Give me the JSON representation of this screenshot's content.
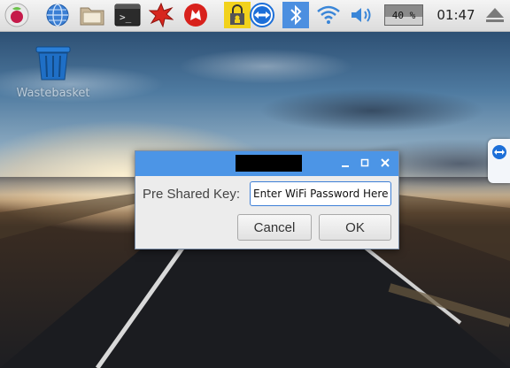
{
  "taskbar": {
    "launchers": [
      "raspberry-menu-icon",
      "web-browser-icon",
      "file-manager-icon",
      "terminal-icon",
      "mathematica-icon",
      "wolfram-icon"
    ],
    "tray": [
      "vnc-lock-icon",
      "teamviewer-icon",
      "bluetooth-icon",
      "wifi-icon",
      "volume-icon",
      "eject-icon"
    ],
    "cpu_percent": 40,
    "cpu_label": "40 %",
    "clock": "01:47",
    "accent": "#4c95e6"
  },
  "desktop": {
    "wastebasket_label": "Wastebasket"
  },
  "dialog": {
    "psk_label": "Pre Shared Key:",
    "psk_value": "Enter WiFi Password Here",
    "cancel_label": "Cancel",
    "ok_label": "OK",
    "titlebar_color": "#4c95e6"
  }
}
